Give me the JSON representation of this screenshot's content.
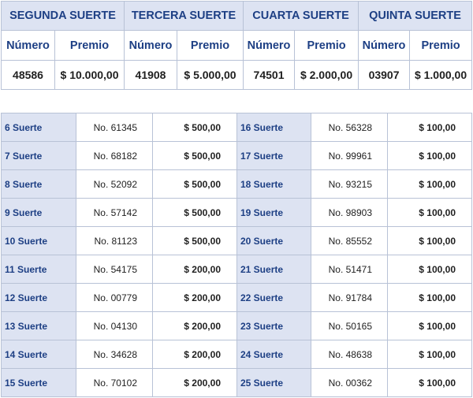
{
  "top": {
    "columns": [
      {
        "title": "SEGUNDA SUERTE",
        "numero_label": "Número",
        "premio_label": "Premio",
        "numero": "48586",
        "premio": "$ 10.000,00"
      },
      {
        "title": "TERCERA SUERTE",
        "numero_label": "Número",
        "premio_label": "Premio",
        "numero": "41908",
        "premio": "$ 5.000,00"
      },
      {
        "title": "CUARTA SUERTE",
        "numero_label": "Número",
        "premio_label": "Premio",
        "numero": "74501",
        "premio": "$ 2.000,00"
      },
      {
        "title": "QUINTA SUERTE",
        "numero_label": "Número",
        "premio_label": "Premio",
        "numero": "03907",
        "premio": "$ 1.000,00"
      }
    ]
  },
  "rows": [
    {
      "left": {
        "label": "6 Suerte",
        "numero": "No. 61345",
        "premio": "$ 500,00"
      },
      "right": {
        "label": "16 Suerte",
        "numero": "No. 56328",
        "premio": "$ 100,00"
      }
    },
    {
      "left": {
        "label": "7 Suerte",
        "numero": "No. 68182",
        "premio": "$ 500,00"
      },
      "right": {
        "label": "17 Suerte",
        "numero": "No. 99961",
        "premio": "$ 100,00"
      }
    },
    {
      "left": {
        "label": "8 Suerte",
        "numero": "No. 52092",
        "premio": "$ 500,00"
      },
      "right": {
        "label": "18 Suerte",
        "numero": "No. 93215",
        "premio": "$ 100,00"
      }
    },
    {
      "left": {
        "label": "9 Suerte",
        "numero": "No. 57142",
        "premio": "$ 500,00"
      },
      "right": {
        "label": "19 Suerte",
        "numero": "No. 98903",
        "premio": "$ 100,00"
      }
    },
    {
      "left": {
        "label": "10 Suerte",
        "numero": "No. 81123",
        "premio": "$ 500,00"
      },
      "right": {
        "label": "20 Suerte",
        "numero": "No. 85552",
        "premio": "$ 100,00"
      }
    },
    {
      "left": {
        "label": "11 Suerte",
        "numero": "No. 54175",
        "premio": "$ 200,00"
      },
      "right": {
        "label": "21 Suerte",
        "numero": "No. 51471",
        "premio": "$ 100,00"
      }
    },
    {
      "left": {
        "label": "12 Suerte",
        "numero": "No. 00779",
        "premio": "$ 200,00"
      },
      "right": {
        "label": "22 Suerte",
        "numero": "No. 91784",
        "premio": "$ 100,00"
      }
    },
    {
      "left": {
        "label": "13 Suerte",
        "numero": "No. 04130",
        "premio": "$ 200,00"
      },
      "right": {
        "label": "23 Suerte",
        "numero": "No. 50165",
        "premio": "$ 100,00"
      }
    },
    {
      "left": {
        "label": "14 Suerte",
        "numero": "No. 34628",
        "premio": "$ 200,00"
      },
      "right": {
        "label": "24 Suerte",
        "numero": "No. 48638",
        "premio": "$ 100,00"
      }
    },
    {
      "left": {
        "label": "15 Suerte",
        "numero": "No. 70102",
        "premio": "$ 200,00"
      },
      "right": {
        "label": "25 Suerte",
        "numero": "No. 00362",
        "premio": "$ 100,00"
      }
    }
  ],
  "colors": {
    "header_bg": "#dde3f2",
    "header_text": "#1d3f84",
    "border": "#b8c2d6",
    "text": "#1f1f1f"
  }
}
